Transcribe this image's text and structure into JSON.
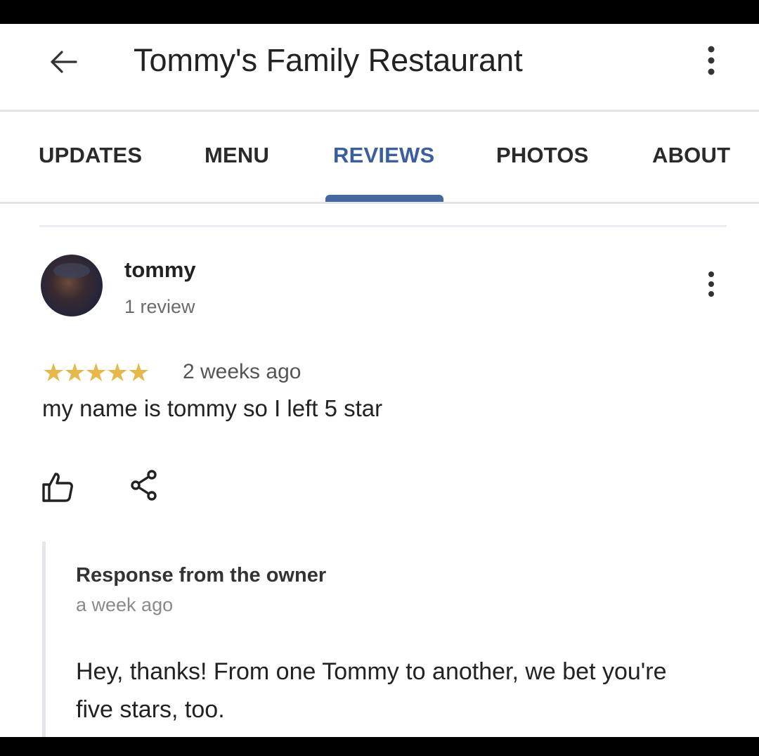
{
  "header": {
    "title": "Tommy's Family Restaurant",
    "back_icon": "arrow-left-icon",
    "menu_icon": "more-vert-icon"
  },
  "tabs": [
    {
      "label": "UPDATES",
      "active": false
    },
    {
      "label": "MENU",
      "active": false
    },
    {
      "label": "REVIEWS",
      "active": true
    },
    {
      "label": "PHOTOS",
      "active": false
    },
    {
      "label": "ABOUT",
      "active": false
    }
  ],
  "colors": {
    "active_tab": "#3b5e9e",
    "star": "#e5b84c",
    "text": "#222222",
    "muted": "#6b6b6b"
  },
  "review": {
    "author": "tommy",
    "author_review_count": "1 review",
    "rating": 5,
    "rating_max": 5,
    "stars_display": "★★★★★",
    "date": "2 weeks ago",
    "text": "my name is tommy so I left 5 star",
    "like_icon": "thumbs-up-icon",
    "share_icon": "share-icon"
  },
  "owner_response": {
    "title": "Response from the owner",
    "date": "a week ago",
    "text": "Hey, thanks! From one Tommy to another, we bet you're five stars, too."
  }
}
